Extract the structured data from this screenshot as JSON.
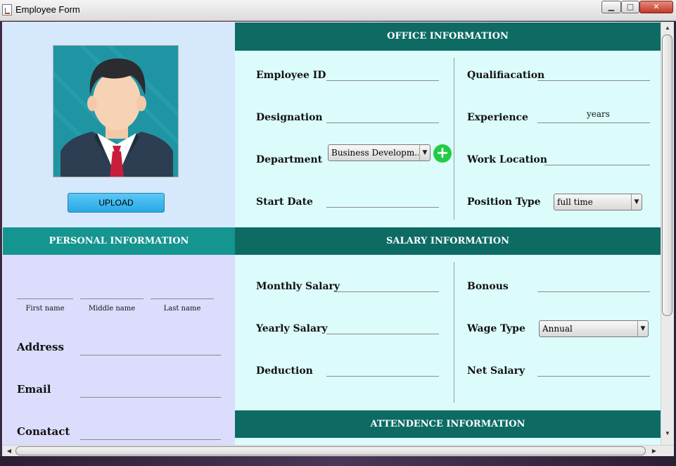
{
  "window": {
    "title": "Employee Form",
    "minimize_glyph": "▁",
    "maximize_glyph": "□",
    "close_glyph": "✕"
  },
  "photo": {
    "icon": "employee-avatar",
    "upload_label": "UPLOAD"
  },
  "office": {
    "header": "OFFICE INFORMATION",
    "employee_id_label": "Employee ID",
    "designation_label": "Designation",
    "department_label": "Department",
    "department_value": "Business Developm...",
    "add_department_glyph": "+",
    "start_date_label": "Start Date",
    "qualification_label": "Qualifiacation",
    "experience_label": "Experience",
    "experience_unit": "years",
    "work_location_label": "Work Location",
    "position_type_label": "Position Type",
    "position_type_value": "full time"
  },
  "personal": {
    "header": "PERSONAL INFORMATION",
    "first_name_label": "First name",
    "middle_name_label": "Middle name",
    "last_name_label": "Last name",
    "address_label": "Address",
    "email_label": "Email",
    "contact_label": "Conatact"
  },
  "salary": {
    "header": "SALARY INFORMATION",
    "monthly_salary_label": "Monthly Salary",
    "yearly_salary_label": "Yearly Salary",
    "deduction_label": "Deduction",
    "bonus_label": "Bonous",
    "wage_type_label": "Wage Type",
    "wage_type_value": "Annual",
    "net_salary_label": "Net Salary"
  },
  "attendance": {
    "header": "ATTENDENCE INFORMATION"
  },
  "scroll": {
    "up_glyph": "▲",
    "down_glyph": "▼",
    "left_glyph": "◀",
    "right_glyph": "▶"
  },
  "colors": {
    "dark_teal": "#0d6b64",
    "teal": "#14958f",
    "light_cyan": "#dcfcfc",
    "lavender": "#dcdcfc",
    "light_blue": "#d6e8fb",
    "upload_blue": "#2aa8e6",
    "add_green": "#22cc44"
  }
}
